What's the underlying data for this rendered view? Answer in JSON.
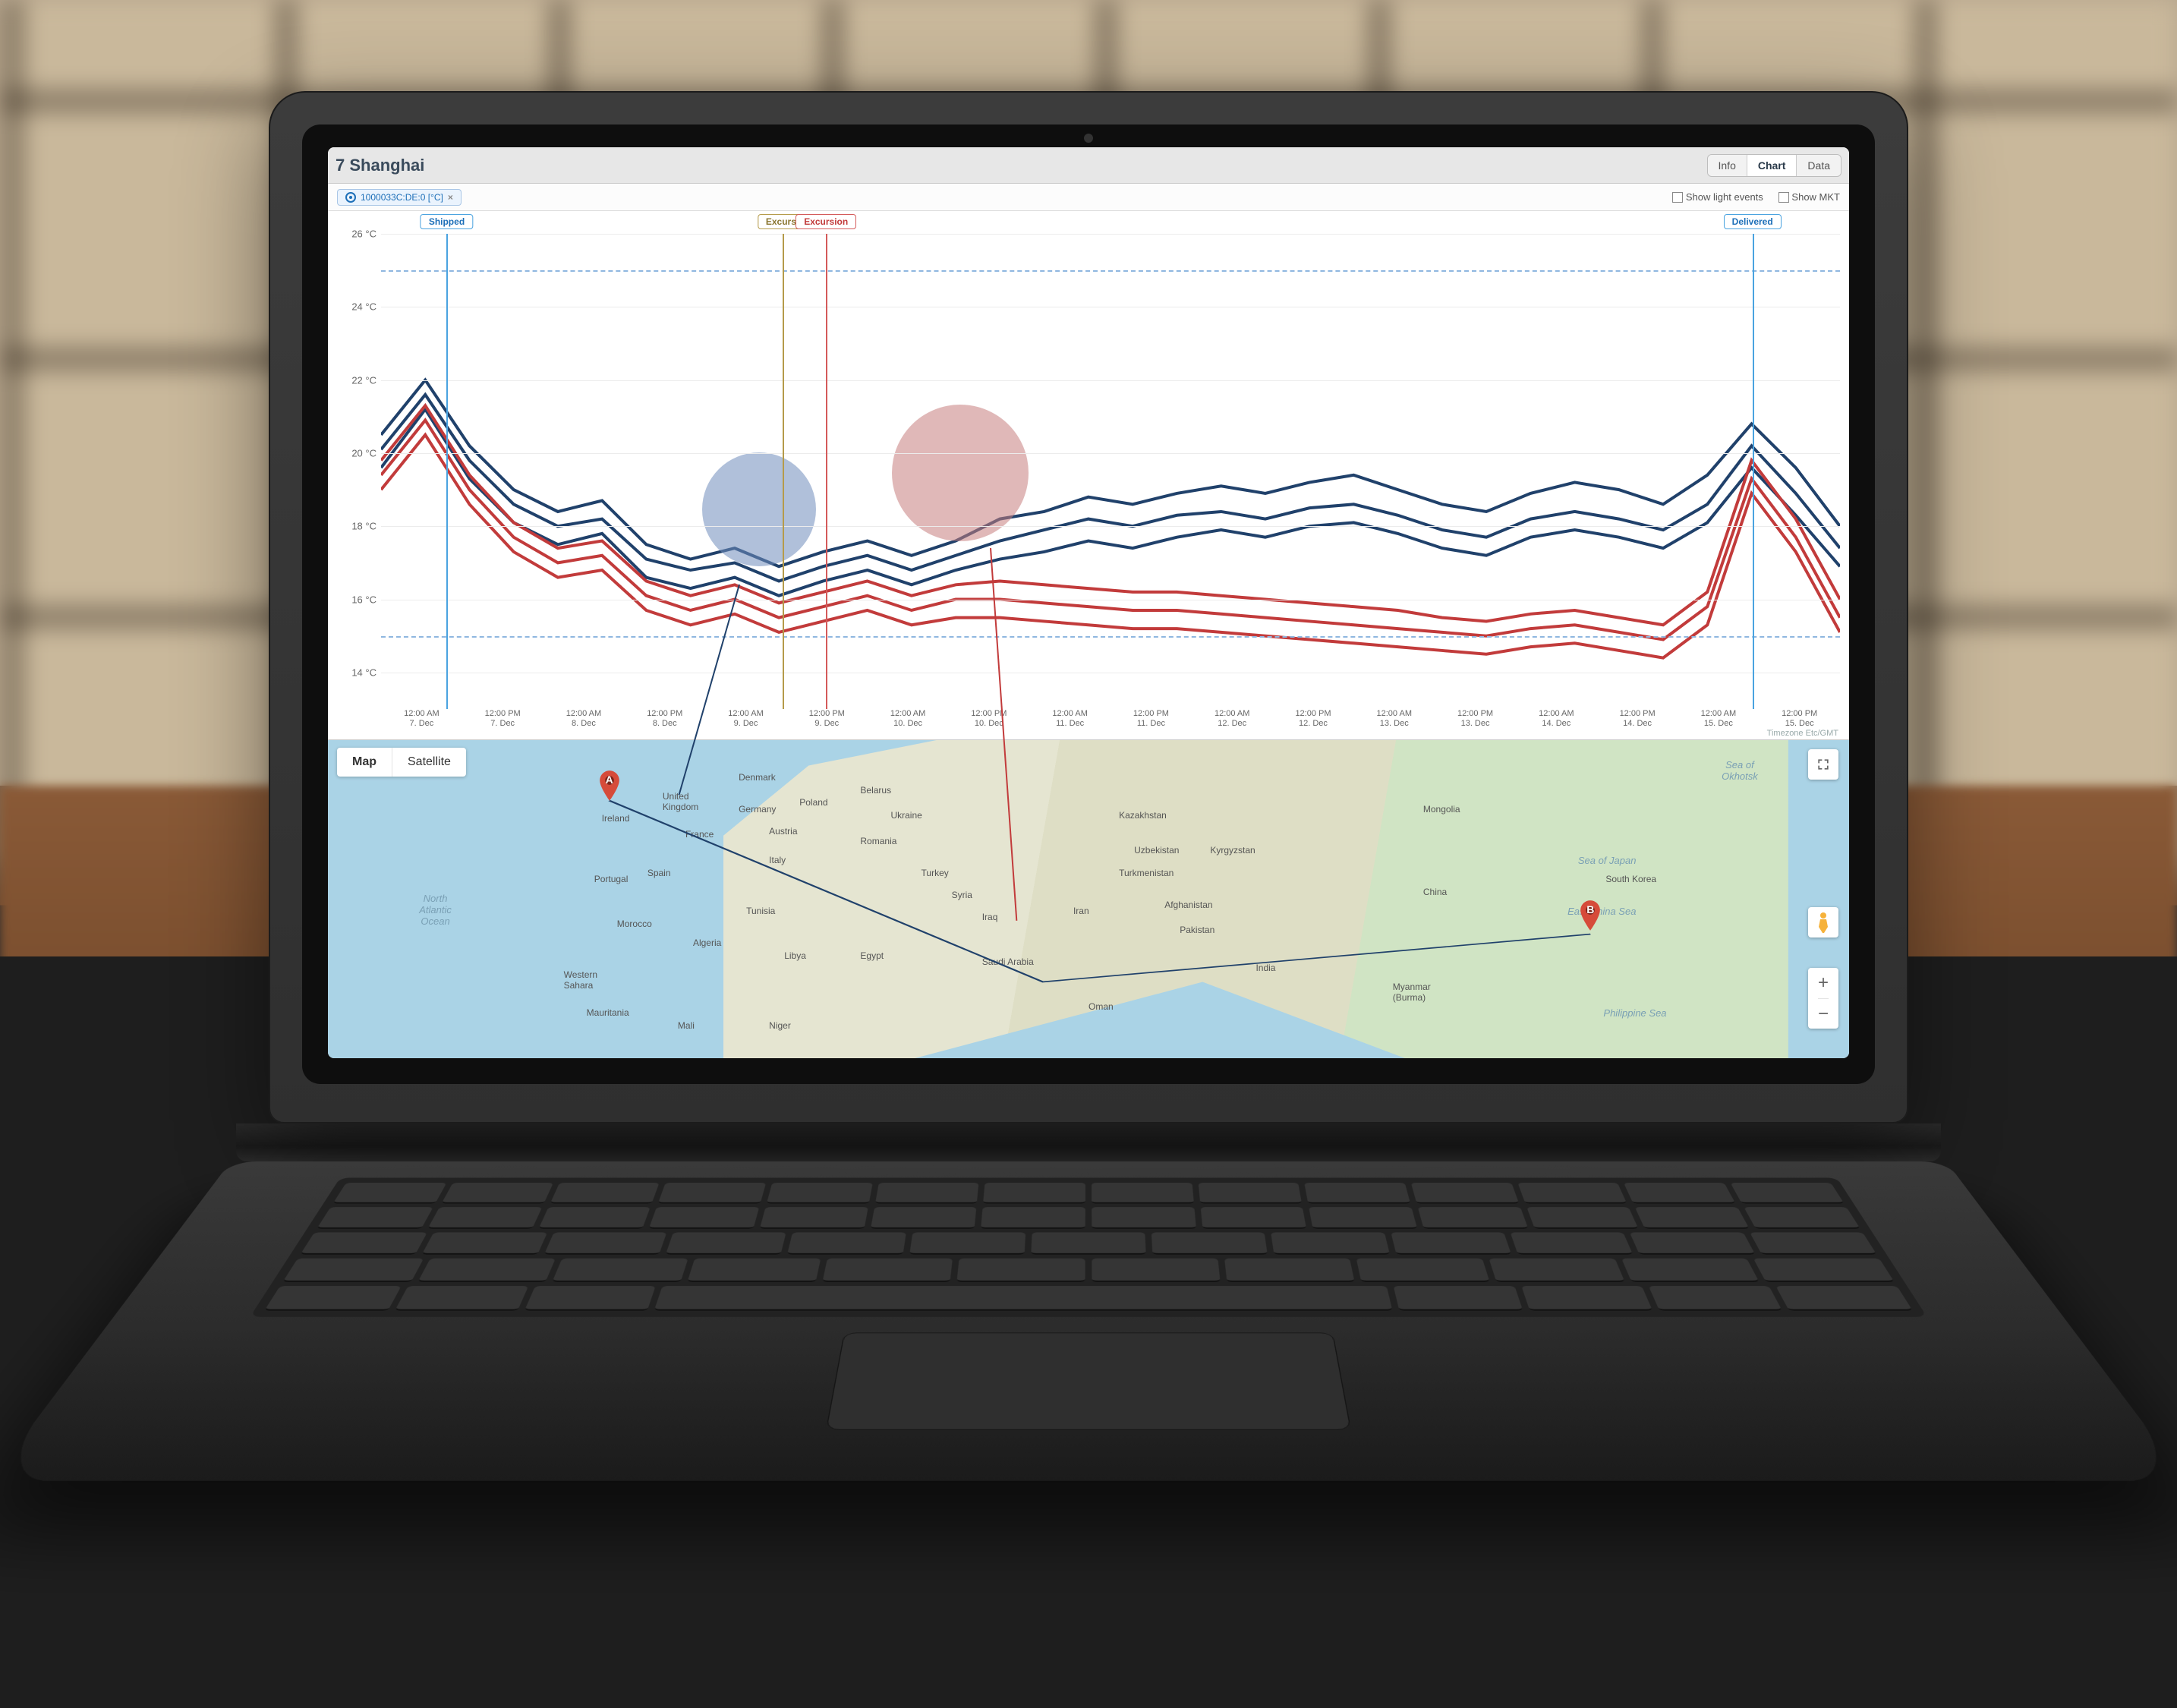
{
  "header": {
    "title": "7 Shanghai",
    "tabs": [
      "Info",
      "Chart",
      "Data"
    ],
    "active_tab": "Chart"
  },
  "toolbar": {
    "sensor_chip": "1000033C:DE:0 [°C]",
    "checkboxes": {
      "light_events": "Show light events",
      "show_mkt": "Show MKT"
    }
  },
  "timezone_note": "Timezone Etc/GMT",
  "events": {
    "shipped": {
      "label": "Shipped",
      "x_pct": 4.5
    },
    "excursion1": {
      "label": "Excursi",
      "x_pct": 27.5
    },
    "excursion2": {
      "label": "Excursion",
      "x_pct": 30.5
    },
    "delivered": {
      "label": "Delivered",
      "x_pct": 94.0
    }
  },
  "chart_data": {
    "type": "line",
    "ylabel": "°C",
    "ylim": [
      13,
      26
    ],
    "y_ticks": [
      14,
      16,
      18,
      20,
      22,
      24,
      26
    ],
    "y_tick_labels": [
      "14 °C",
      "16 °C",
      "18 °C",
      "20 °C",
      "22 °C",
      "24 °C",
      "26 °C"
    ],
    "upper_limit": 25,
    "lower_limit": 15,
    "x_ticks": [
      {
        "top": "12:00 AM",
        "bottom": "7. Dec"
      },
      {
        "top": "12:00 PM",
        "bottom": "7. Dec"
      },
      {
        "top": "12:00 AM",
        "bottom": "8. Dec"
      },
      {
        "top": "12:00 PM",
        "bottom": "8. Dec"
      },
      {
        "top": "12:00 AM",
        "bottom": "9. Dec"
      },
      {
        "top": "12:00 PM",
        "bottom": "9. Dec"
      },
      {
        "top": "12:00 AM",
        "bottom": "10. Dec"
      },
      {
        "top": "12:00 PM",
        "bottom": "10. Dec"
      },
      {
        "top": "12:00 AM",
        "bottom": "11. Dec"
      },
      {
        "top": "12:00 PM",
        "bottom": "11. Dec"
      },
      {
        "top": "12:00 AM",
        "bottom": "12. Dec"
      },
      {
        "top": "12:00 PM",
        "bottom": "12. Dec"
      },
      {
        "top": "12:00 AM",
        "bottom": "13. Dec"
      },
      {
        "top": "12:00 PM",
        "bottom": "13. Dec"
      },
      {
        "top": "12:00 AM",
        "bottom": "14. Dec"
      },
      {
        "top": "12:00 PM",
        "bottom": "14. Dec"
      },
      {
        "top": "12:00 AM",
        "bottom": "15. Dec"
      },
      {
        "top": "12:00 PM",
        "bottom": "15. Dec"
      }
    ],
    "series": [
      {
        "name": "blue-high",
        "color": "#20416b",
        "values": [
          20.5,
          22.0,
          20.2,
          19.0,
          18.4,
          18.7,
          17.5,
          17.1,
          17.4,
          16.9,
          17.3,
          17.6,
          17.2,
          17.6,
          18.2,
          18.4,
          18.8,
          18.6,
          18.9,
          19.1,
          18.9,
          19.2,
          19.4,
          19.0,
          18.6,
          18.4,
          18.9,
          19.2,
          19.0,
          18.6,
          19.4,
          20.8,
          19.6,
          18.0
        ]
      },
      {
        "name": "blue-mid",
        "color": "#20416b",
        "values": [
          20.1,
          21.6,
          19.8,
          18.6,
          18.0,
          18.2,
          17.1,
          16.8,
          17.0,
          16.5,
          16.9,
          17.2,
          16.8,
          17.2,
          17.6,
          17.9,
          18.2,
          18.0,
          18.3,
          18.4,
          18.2,
          18.5,
          18.6,
          18.3,
          17.9,
          17.7,
          18.2,
          18.4,
          18.2,
          17.9,
          18.6,
          20.2,
          18.9,
          17.4
        ]
      },
      {
        "name": "blue-low",
        "color": "#20416b",
        "values": [
          19.6,
          21.2,
          19.3,
          18.1,
          17.5,
          17.8,
          16.6,
          16.3,
          16.6,
          16.1,
          16.5,
          16.8,
          16.4,
          16.8,
          17.1,
          17.3,
          17.6,
          17.4,
          17.7,
          17.9,
          17.7,
          18.0,
          18.1,
          17.8,
          17.4,
          17.2,
          17.7,
          17.9,
          17.7,
          17.4,
          18.1,
          19.6,
          18.3,
          16.9
        ]
      },
      {
        "name": "red-high",
        "color": "#c23b3b",
        "values": [
          19.8,
          21.3,
          19.4,
          18.1,
          17.4,
          17.6,
          16.5,
          16.1,
          16.4,
          15.9,
          16.2,
          16.5,
          16.1,
          16.4,
          16.5,
          16.4,
          16.3,
          16.2,
          16.2,
          16.1,
          16.0,
          15.9,
          15.8,
          15.7,
          15.5,
          15.4,
          15.6,
          15.7,
          15.5,
          15.3,
          16.2,
          19.8,
          18.2,
          16.0
        ]
      },
      {
        "name": "red-mid",
        "color": "#c23b3b",
        "values": [
          19.4,
          20.9,
          19.0,
          17.7,
          17.0,
          17.2,
          16.1,
          15.7,
          16.0,
          15.5,
          15.8,
          16.1,
          15.7,
          16.0,
          16.0,
          15.9,
          15.8,
          15.7,
          15.7,
          15.6,
          15.5,
          15.4,
          15.3,
          15.2,
          15.1,
          15.0,
          15.2,
          15.3,
          15.1,
          14.9,
          15.8,
          19.3,
          17.7,
          15.5
        ]
      },
      {
        "name": "red-low",
        "color": "#c23b3b",
        "values": [
          19.0,
          20.5,
          18.6,
          17.3,
          16.6,
          16.8,
          15.7,
          15.3,
          15.6,
          15.1,
          15.4,
          15.7,
          15.3,
          15.5,
          15.5,
          15.4,
          15.3,
          15.2,
          15.2,
          15.1,
          15.0,
          14.9,
          14.8,
          14.7,
          14.6,
          14.5,
          14.7,
          14.8,
          14.6,
          14.4,
          15.3,
          18.9,
          17.3,
          15.1
        ]
      }
    ]
  },
  "map": {
    "toggle": {
      "map": "Map",
      "satellite": "Satellite",
      "active": "Map"
    },
    "markers": {
      "A": "A",
      "B": "B"
    },
    "controls": {
      "zoom_in": "+",
      "zoom_out": "−"
    },
    "seas": {
      "north_atlantic": "North\nAtlantic\nOcean",
      "okhotsk": "Sea of\nOkhotsk",
      "japan": "Sea of Japan",
      "east_china": "East China Sea",
      "philippine": "Philippine Sea"
    },
    "countries": {
      "ireland": "Ireland",
      "uk": "United\nKingdom",
      "denmark": "Denmark",
      "belarus": "Belarus",
      "germany": "Germany",
      "poland": "Poland",
      "ukraine": "Ukraine",
      "france": "France",
      "austria": "Austria",
      "romania": "Romania",
      "kazakhstan": "Kazakhstan",
      "mongolia": "Mongolia",
      "italy": "Italy",
      "spain": "Spain",
      "portugal": "Portugal",
      "uzbekistan": "Uzbekistan",
      "kyrgyzstan": "Kyrgyzstan",
      "turkey": "Turkey",
      "turkmenistan": "Turkmenistan",
      "syria": "Syria",
      "china": "China",
      "south_korea": "South Korea",
      "morocco": "Morocco",
      "iraq": "Iraq",
      "iran": "Iran",
      "afghanistan": "Afghanistan",
      "algeria": "Algeria",
      "tunisia": "Tunisia",
      "libya": "Libya",
      "pakistan": "Pakistan",
      "egypt": "Egypt",
      "western_sahara": "Western\nSahara",
      "saudi": "Saudi Arabia",
      "india": "India",
      "myanmar": "Myanmar\n(Burma)",
      "mauritania": "Mauritania",
      "mali": "Mali",
      "niger": "Niger",
      "oman": "Oman"
    }
  }
}
